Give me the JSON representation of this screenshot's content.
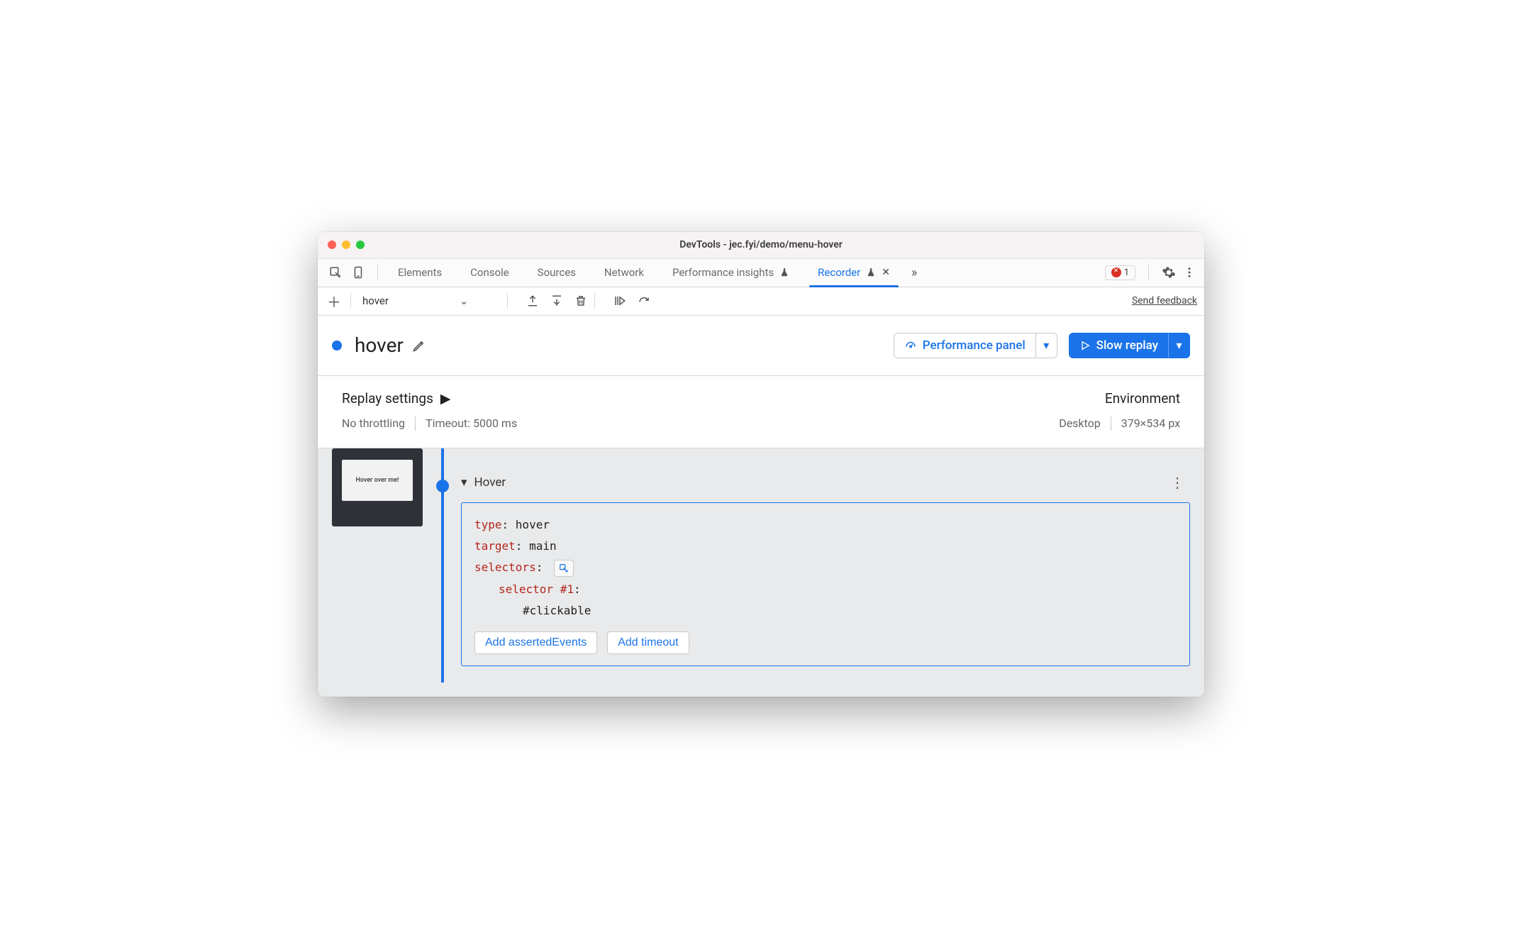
{
  "window": {
    "title": "DevTools - jec.fyi/demo/menu-hover"
  },
  "tabs": {
    "items": [
      "Elements",
      "Console",
      "Sources",
      "Network",
      "Performance insights",
      "Recorder"
    ],
    "errors_count": "1"
  },
  "toolbar": {
    "active_recording": "hover",
    "feedback": "Send feedback"
  },
  "header": {
    "name": "hover",
    "perf_button": "Performance panel",
    "replay_button": "Slow replay"
  },
  "settings": {
    "heading": "Replay settings",
    "throttling": "No throttling",
    "timeout": "Timeout: 5000 ms",
    "env_heading": "Environment",
    "env_device": "Desktop",
    "env_dims": "379×534 px"
  },
  "timeline": {
    "thumb_label": "Hover over me!",
    "step_title": "Hover",
    "details": {
      "type_key": "type",
      "type_val": "hover",
      "target_key": "target",
      "target_val": "main",
      "selectors_key": "selectors",
      "selector_n_key": "selector #1",
      "selector_val": "#clickable"
    },
    "add_asserted": "Add assertedEvents",
    "add_timeout": "Add timeout"
  }
}
